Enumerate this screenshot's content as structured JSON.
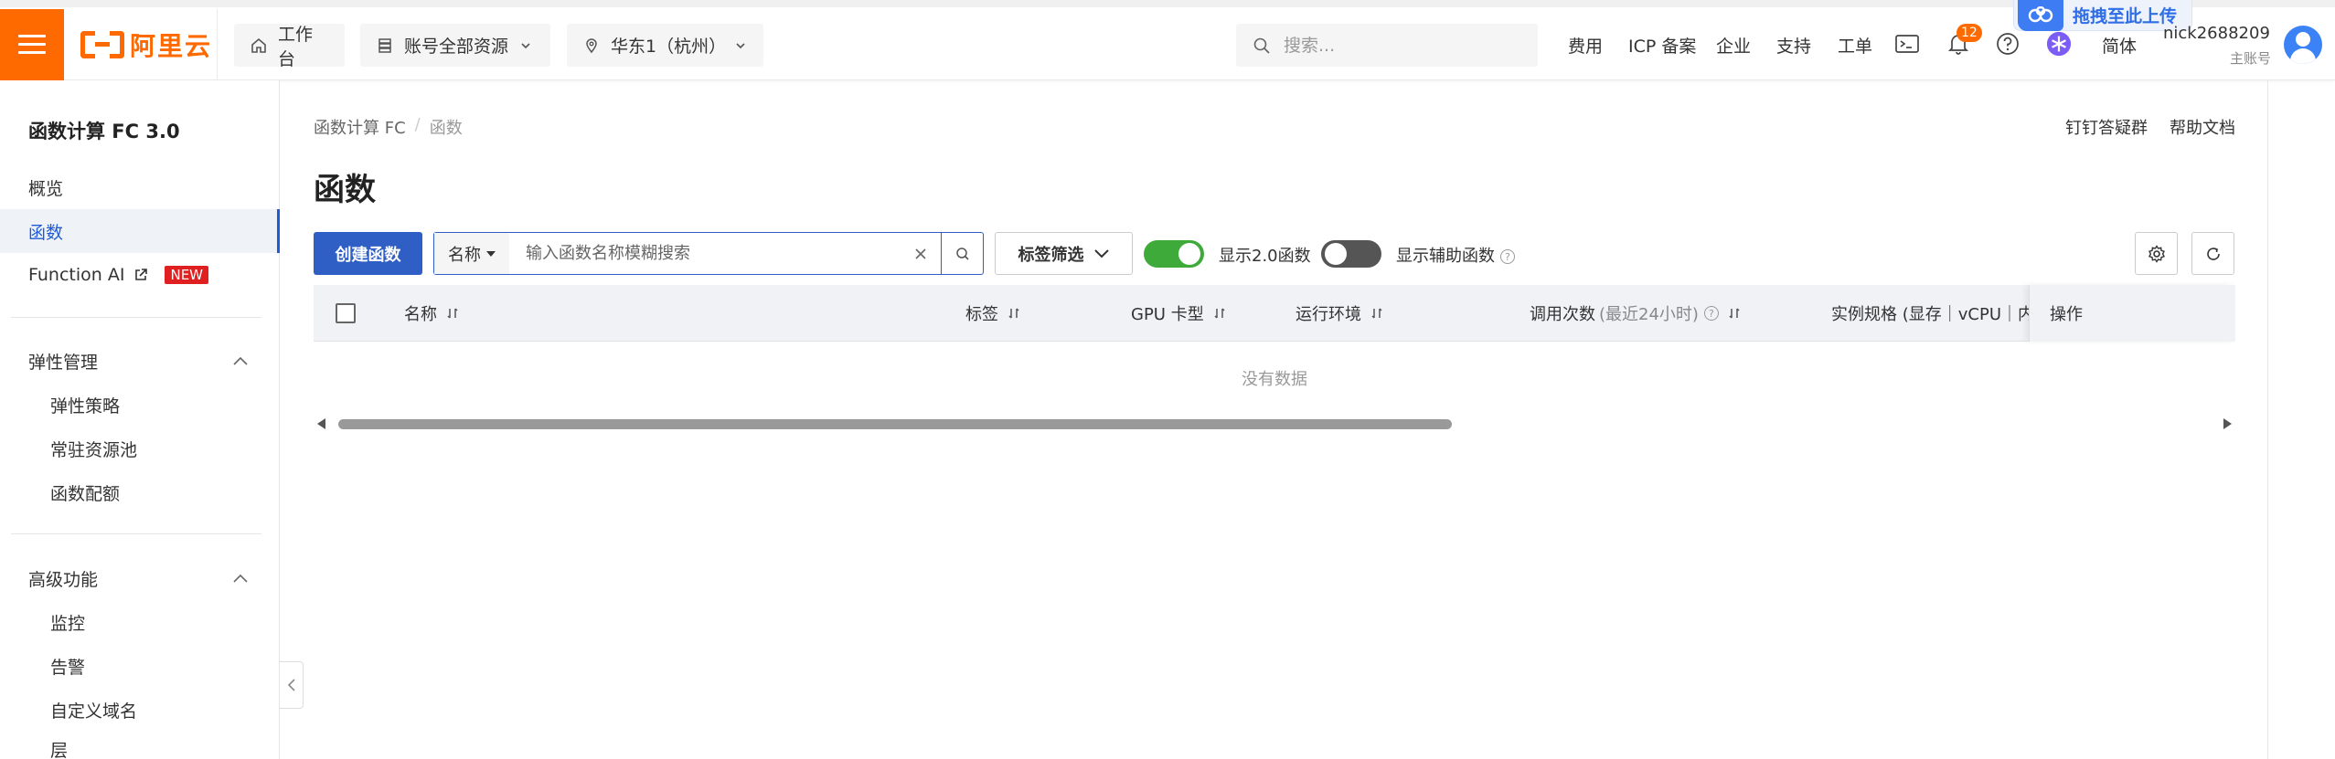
{
  "topbar": {
    "logo_text": "阿里云",
    "workbench_label": "工作台",
    "account_resources_label": "账号全部资源",
    "region_label": "华东1（杭州）",
    "search_placeholder": "搜索...",
    "links": [
      "费用",
      "ICP 备案",
      "企业",
      "支持",
      "工单"
    ],
    "notification_count": "12",
    "language_label": "简体",
    "account_name": "nick2688209...",
    "account_type": "主账号",
    "upload_float_label": "拖拽至此上传",
    "brand_color": "#ff6a00"
  },
  "sidebar": {
    "title": "函数计算 FC 3.0",
    "items": [
      {
        "label": "概览"
      },
      {
        "label": "函数",
        "active": true
      },
      {
        "label": "Function AI",
        "tag": "NEW"
      }
    ],
    "groups": [
      {
        "label": "弹性管理",
        "items": [
          "弹性策略",
          "常驻资源池",
          "函数配额"
        ]
      },
      {
        "label": "高级功能",
        "items": [
          "监控",
          "告警",
          "自定义域名",
          "层"
        ]
      }
    ]
  },
  "main": {
    "breadcrumb": [
      "函数计算 FC",
      "函数"
    ],
    "header_links": [
      "钉钉答疑群",
      "帮助文档"
    ],
    "page_title": "函数",
    "create_button": "创建函数",
    "search": {
      "field_select": "名称",
      "placeholder": "输入函数名称模糊搜索"
    },
    "tag_filter_label": "标签筛选",
    "toggle_v2": {
      "label": "显示2.0函数",
      "on": true
    },
    "toggle_aux": {
      "label": "显示辅助函数",
      "on": false
    },
    "table": {
      "columns": [
        "名称",
        "标签",
        "GPU 卡型",
        "运行环境",
        "调用次数",
        "实例规格 (显存｜vCPU｜内存",
        "操作"
      ],
      "call_count_hint": "(最近24小时)",
      "empty_text": "没有数据"
    }
  }
}
